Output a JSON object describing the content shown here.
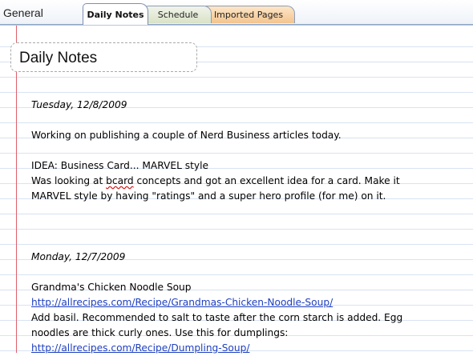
{
  "notebook": {
    "title": "General"
  },
  "tabs": [
    {
      "label": "Daily Notes",
      "active": true
    },
    {
      "label": "Schedule",
      "color": "#d9e2c6"
    },
    {
      "label": "Imported Pages",
      "color": "#f3c48e"
    }
  ],
  "page": {
    "title": "Daily Notes",
    "entries": [
      {
        "date": "Tuesday, 12/8/2009",
        "line1": "Working on publishing a couple of Nerd Business articles today.",
        "idea": "IDEA: Business Card...  MARVEL style",
        "body_a_pre": "Was looking at ",
        "body_a_misspelled": "bcard",
        "body_a_post": " concepts and got an excellent idea for a card.   Make it",
        "body_b": "MARVEL style by having \"ratings\" and a super hero profile (for me) on it."
      },
      {
        "date": "Monday, 12/7/2009",
        "heading": "Grandma's Chicken Noodle Soup",
        "link1": "http://allrecipes.com/Recipe/Grandmas-Chicken-Noodle-Soup/",
        "body_a": "Add basil.  Recommended to salt to taste after the corn starch is added.  Egg",
        "body_b": "noodles are thick curly ones.  Use this for dumplings:",
        "link2": "http://allrecipes.com/Recipe/Dumpling-Soup/"
      }
    ]
  },
  "colors": {
    "margin_line": "#e0606a",
    "rule_line": "#d7e3f2",
    "link": "#1f3fbf"
  }
}
